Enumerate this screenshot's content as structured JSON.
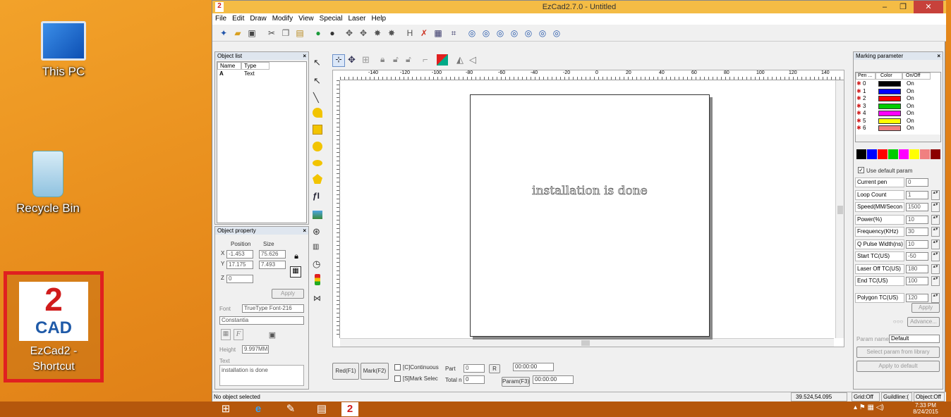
{
  "desktop": {
    "icons": [
      {
        "label": "This PC"
      },
      {
        "label": "Recycle Bin"
      },
      {
        "label_line1": "EzCad2 -",
        "label_line2": "Shortcut",
        "logo_number": "2",
        "logo_text": "CAD"
      }
    ]
  },
  "window": {
    "title": "EzCad2.7.0 - Untitled",
    "app_icon_text": "2",
    "controls": {
      "minimize": "–",
      "restore": "❐",
      "close": "✕"
    }
  },
  "menu": [
    "File",
    "Edit",
    "Draw",
    "Modify",
    "View",
    "Special",
    "Laser",
    "Help"
  ],
  "object_list": {
    "title": "Object list",
    "close": "×",
    "columns": [
      "Name",
      "Type"
    ],
    "rows": [
      {
        "name": "A",
        "type": "Text"
      }
    ]
  },
  "object_property": {
    "title": "Object property",
    "close": "×",
    "position_label": "Position",
    "size_label": "Size",
    "x_label": "X",
    "y_label": "Y",
    "z_label": "Z",
    "x_value": "-1.453",
    "y_value": "17.175",
    "z_value": "0",
    "w_value": "75.626",
    "h_value": "7.493",
    "apply": "Apply",
    "font_label": "Font",
    "font_type": "TrueType Font-216",
    "font_name": "Constantia",
    "f_symbol": "F",
    "height_label": "Height",
    "height_value": "9.997MM",
    "text_label": "Text",
    "text_value": "installation is done"
  },
  "canvas": {
    "ruler_numbers": [
      "-140",
      "-120",
      "-100",
      "-80",
      "-60",
      "-40",
      "-20",
      "0",
      "20",
      "40",
      "60",
      "80",
      "100",
      "120",
      "140"
    ],
    "sheet_text": "installation is done"
  },
  "bottom_controls": {
    "red": "Red(F1)",
    "mark": "Mark(F2)",
    "continuous": "[C]Continuous",
    "part_label": "Part",
    "part_value": "0",
    "r_label": "R",
    "time1": "00:00:00",
    "mark_select": "[S]Mark Selec",
    "total_label": "Total n",
    "total_value": "0",
    "param": "Param(F3)",
    "time2": "00:00:00"
  },
  "marking": {
    "title": "Marking parameter",
    "close": "×",
    "columns": [
      "Pen ...",
      "Color",
      "On/Off"
    ],
    "pens": [
      {
        "id": "0",
        "color": "#000000",
        "state": "On"
      },
      {
        "id": "1",
        "color": "#0000ff",
        "state": "On"
      },
      {
        "id": "2",
        "color": "#ff0000",
        "state": "On"
      },
      {
        "id": "3",
        "color": "#00cc00",
        "state": "On"
      },
      {
        "id": "4",
        "color": "#ff00ff",
        "state": "On"
      },
      {
        "id": "5",
        "color": "#ffff00",
        "state": "On"
      },
      {
        "id": "6",
        "color": "#f08080",
        "state": "On"
      }
    ],
    "palette": [
      "#000000",
      "#0000ff",
      "#ff0000",
      "#00cc00",
      "#ff00ff",
      "#ffff00",
      "#f08080",
      "#8b0000"
    ],
    "use_default": "Use default param",
    "params": [
      {
        "label": "Current pen",
        "value": "0"
      },
      {
        "label": "Loop Count",
        "value": "1"
      },
      {
        "label": "Speed(MM/Secon",
        "value": "1500"
      },
      {
        "label": "Power(%)",
        "value": "10"
      },
      {
        "label": "Frequency(KHz)",
        "value": "30"
      },
      {
        "label": "Q Pulse Width(ns)",
        "value": "10"
      },
      {
        "label": "Start TC(US)",
        "value": "-50"
      },
      {
        "label": "Laser Off TC(US)",
        "value": "180"
      },
      {
        "label": "End TC(US)",
        "value": "100"
      },
      {
        "label": "Polygon TC(US)",
        "value": "120"
      }
    ],
    "apply": "Apply",
    "advance": "Advance...",
    "param_name_label": "Param name",
    "param_name_value": "Default",
    "select_from_library": "Select param from library",
    "apply_default": "Apply to default"
  },
  "status": {
    "message": "No object selected",
    "coords": "39.524,54.095",
    "grid": "Grid:Off",
    "guideline": "Guildline:(",
    "object": "Object:Off"
  },
  "taskbar": {
    "time": "7:33 PM",
    "date": "8/24/2015"
  }
}
